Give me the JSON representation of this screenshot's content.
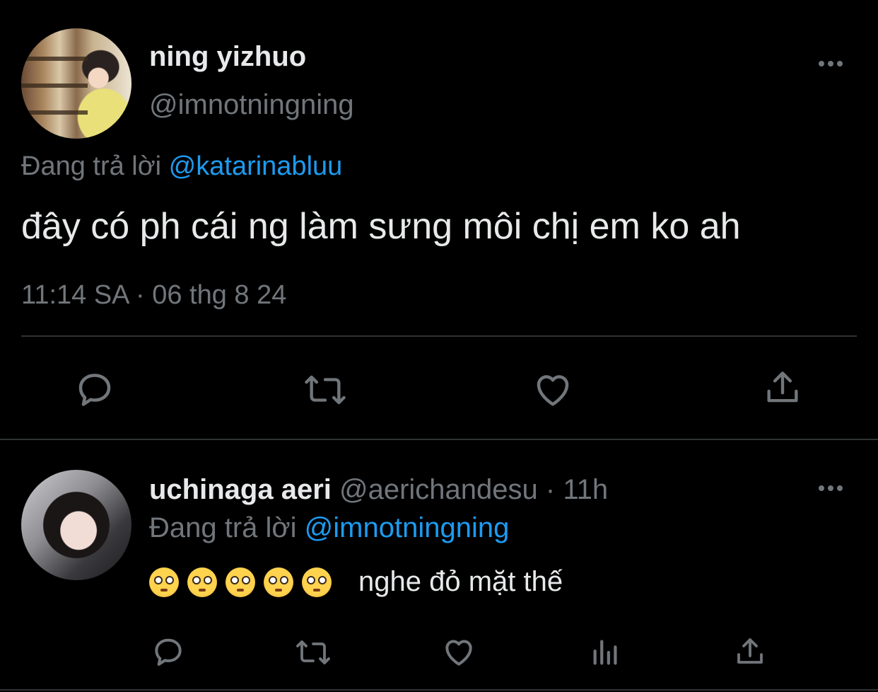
{
  "main_tweet": {
    "display_name": "ning yizhuo",
    "handle": "@imnotningning",
    "reply_prefix": "Đang trả lời",
    "reply_to": "@katarinabluu",
    "text": "đây có ph cái ng làm sưng môi chị em ko ah",
    "timestamp": "11:14 SA · 06 thg 8 24",
    "actions": [
      "reply-icon",
      "retweet-icon",
      "like-icon",
      "share-icon"
    ]
  },
  "reply_tweet": {
    "display_name": "uchinaga aeri",
    "handle": "@aerichandesu",
    "separator": " · ",
    "time_ago": "11h",
    "reply_prefix": "Đang trả lời",
    "reply_to": "@imnotningning",
    "emoji_count": 5,
    "emoji_name": "flushed-face-emoji",
    "text": "nghe đỏ mặt thế",
    "actions": [
      "reply-icon",
      "retweet-icon",
      "like-icon",
      "views-icon",
      "share-icon"
    ]
  },
  "colors": {
    "background": "#000000",
    "primary_text": "#e7e9ea",
    "secondary_text": "#71767b",
    "link": "#1d9bf0",
    "divider": "#2f3336"
  }
}
